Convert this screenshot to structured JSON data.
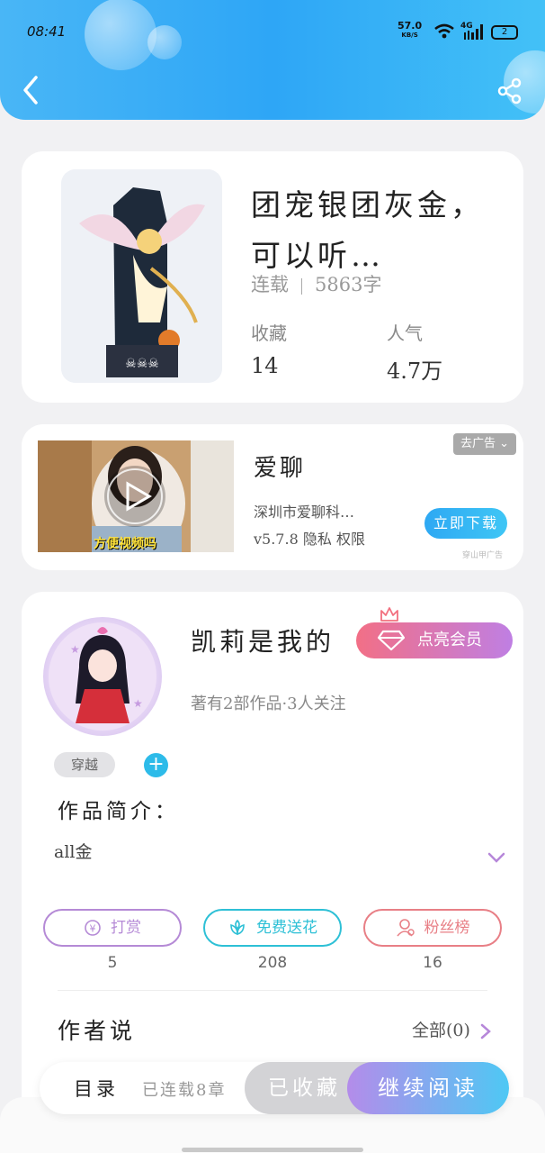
{
  "status": {
    "time": "08:41",
    "net_speed": "57.0",
    "net_unit": "KB/S",
    "signal_type": "4G",
    "battery": "2"
  },
  "header": {
    "back_icon": "back-arrow-icon",
    "share_icon": "share-icon"
  },
  "book": {
    "title": "团宠银团灰金，可以听…",
    "status": "连载",
    "word_count": "5863字",
    "collect_label": "收藏",
    "collect_value": "14",
    "popularity_label": "人气",
    "popularity_value": "4.7万"
  },
  "ad": {
    "title": "爱聊",
    "tag": "去广告",
    "company": "深圳市爱聊科…",
    "version": "v5.7.8",
    "privacy": "隐私",
    "permission": "权限",
    "button": "立即下载",
    "source": "穿山甲广告",
    "video_caption": "方便视频吗"
  },
  "author": {
    "name": "凯莉是我的",
    "vip_button": "点亮会员",
    "summary": "著有2部作品·3人关注",
    "tag": "穿越",
    "intro_label": "作品简介：",
    "intro_text": "all金",
    "actions": [
      {
        "label": "打赏",
        "count": "5",
        "color": "#b58ad6"
      },
      {
        "label": "免费送花",
        "count": "208",
        "color": "#2ec0d6"
      },
      {
        "label": "粉丝榜",
        "count": "16",
        "color": "#e87f86"
      }
    ],
    "author_says_label": "作者说",
    "author_says_all": "全部(0)"
  },
  "bottom": {
    "toc": "目录",
    "serial": "已连载8章",
    "collected": "已收藏",
    "continue": "继续阅读"
  }
}
